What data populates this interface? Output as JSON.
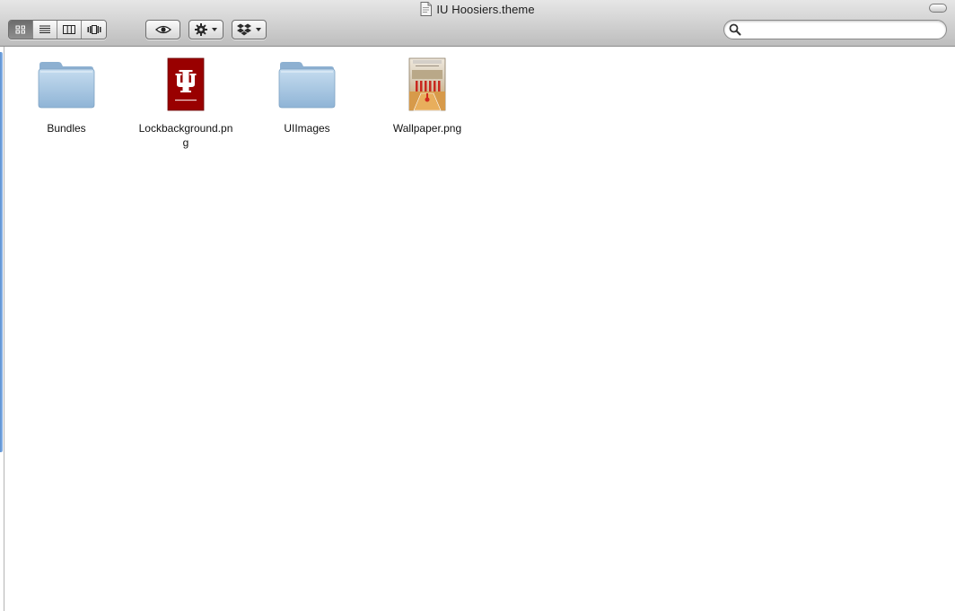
{
  "window": {
    "title": "IU Hoosiers.theme"
  },
  "toolbar": {
    "view_buttons": [
      {
        "name": "icon-view",
        "icon": "icon-grid-icon",
        "active": true
      },
      {
        "name": "list-view",
        "icon": "list-icon",
        "active": false
      },
      {
        "name": "column-view",
        "icon": "columns-icon",
        "active": false
      },
      {
        "name": "coverflow-view",
        "icon": "coverflow-icon",
        "active": false
      }
    ],
    "quicklook_icon": "eye-icon",
    "action_icon": "gear-icon",
    "dropbox_icon": "dropbox-icon",
    "search": {
      "value": "",
      "placeholder": ""
    }
  },
  "files": [
    {
      "name": "Bundles",
      "kind": "folder",
      "icon": "folder-icon"
    },
    {
      "name": "Lockbackground.png",
      "kind": "image",
      "icon": "iu-logo-icon"
    },
    {
      "name": "UIImages",
      "kind": "folder",
      "icon": "folder-icon"
    },
    {
      "name": "Wallpaper.png",
      "kind": "image",
      "icon": "basketball-court-icon"
    }
  ],
  "colors": {
    "iu_crimson": "#990000",
    "folder_blue": "#9ec1e0",
    "selection_blue": "#6b9bd8"
  }
}
